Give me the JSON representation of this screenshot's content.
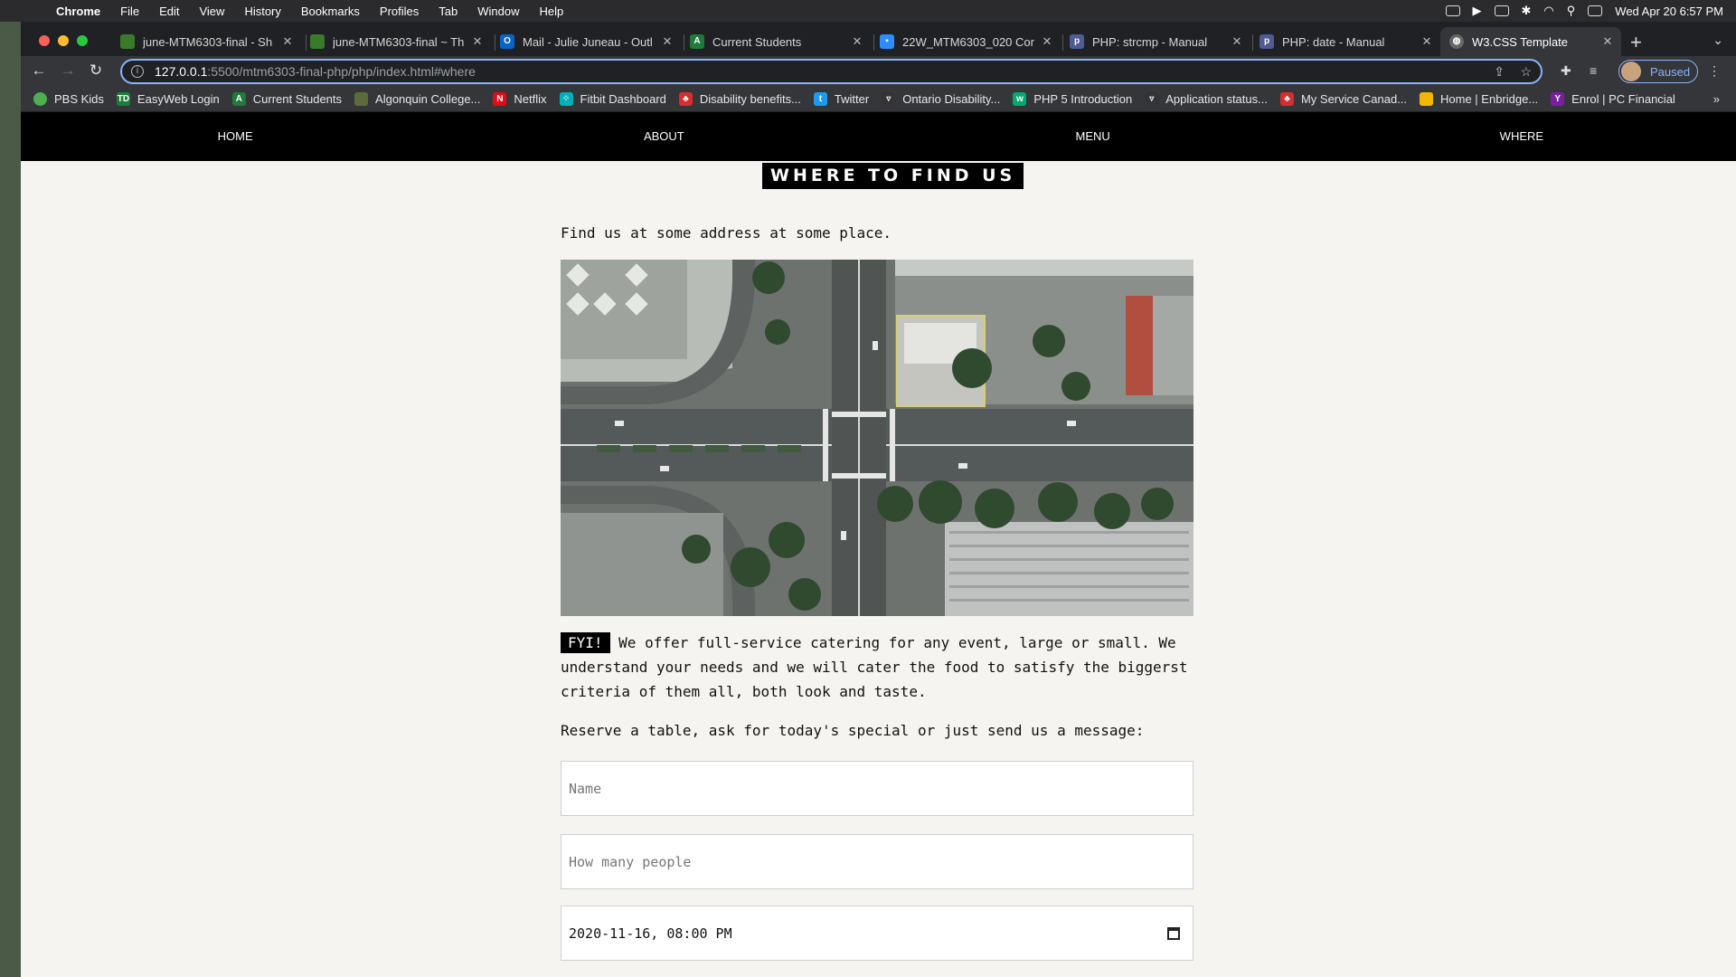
{
  "menubar": {
    "app": "Chrome",
    "items": [
      "File",
      "Edit",
      "View",
      "History",
      "Bookmarks",
      "Profiles",
      "Tab",
      "Window",
      "Help"
    ],
    "datetime": "Wed Apr 20  6:57 PM"
  },
  "tabs": [
    {
      "title": "june-MTM6303-final - Sh",
      "color": "#3b7a2b"
    },
    {
      "title": "june-MTM6303-final ~ Th",
      "color": "#3b7a2b"
    },
    {
      "title": "Mail - Julie Juneau - Outl",
      "color": "#0a64c8"
    },
    {
      "title": "Current Students",
      "color": "#1f7a3c"
    },
    {
      "title": "22W_MTM6303_020 Cor",
      "color": "#2d8cff"
    },
    {
      "title": "PHP: strcmp - Manual",
      "color": "#4f5b93"
    },
    {
      "title": "PHP: date - Manual",
      "color": "#4f5b93"
    },
    {
      "title": "W3.CSS Template",
      "color": "#777"
    }
  ],
  "omnibox": {
    "host": "127.0.0.1",
    "path": ":5500/mtm6303-final-php/php/index.html#where"
  },
  "profile": {
    "label": "Paused"
  },
  "bookmarks": [
    {
      "label": "PBS Kids",
      "color": "#4caf50"
    },
    {
      "label": "EasyWeb Login",
      "color": "#1a7f37"
    },
    {
      "label": "Current Students",
      "color": "#1f7a3c"
    },
    {
      "label": "Algonquin College...",
      "color": "#5c6b3a"
    },
    {
      "label": "Netflix",
      "color": "#e50914"
    },
    {
      "label": "Fitbit Dashboard",
      "color": "#00b0b9"
    },
    {
      "label": "Disability benefits...",
      "color": "#d32f2f"
    },
    {
      "label": "Twitter",
      "color": "#1d9bf0"
    },
    {
      "label": "Ontario Disability...",
      "color": "#333"
    },
    {
      "label": "PHP 5 Introduction",
      "color": "#04aa6d"
    },
    {
      "label": "Application status...",
      "color": "#333"
    },
    {
      "label": "My Service Canad...",
      "color": "#d32f2f"
    },
    {
      "label": "Home | Enbridge...",
      "color": "#f2b705"
    },
    {
      "label": "Enrol | PC Financial",
      "color": "#7b1fa2"
    }
  ],
  "nav": {
    "home": "HOME",
    "about": "ABOUT",
    "menu": "MENU",
    "where": "WHERE"
  },
  "where": {
    "title": "WHERE TO FIND US",
    "intro": "Find us at some address at some place.",
    "fyi_badge": "FYI!",
    "fyi_text": " We offer full-service catering for any event, large or small. We understand your needs and we will cater the food to satisfy the biggerst criteria of them all, both look and taste.",
    "reserve": "Reserve a table, ask for today's special or just send us a message:",
    "name_placeholder": "Name",
    "people_placeholder": "How many people",
    "date_value": "2020-11-16, 08:00 PM"
  }
}
